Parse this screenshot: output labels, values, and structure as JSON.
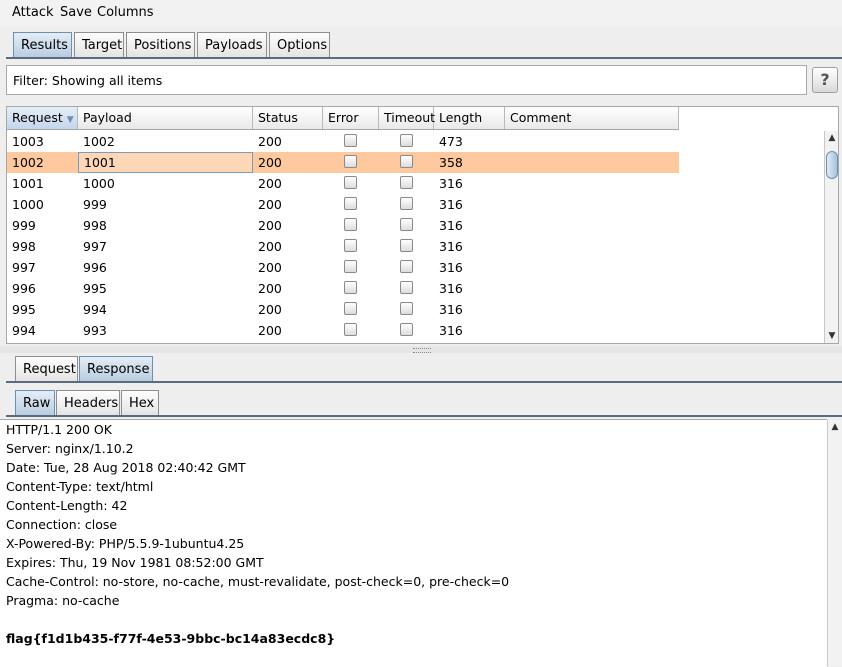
{
  "menu": [
    "Attack",
    "Save",
    "Columns"
  ],
  "main_tabs": [
    "Results",
    "Target",
    "Positions",
    "Payloads",
    "Options"
  ],
  "filter_text": "Filter: Showing all items",
  "help_label": "?",
  "columns": [
    "Request",
    "Payload",
    "Status",
    "Error",
    "Timeout",
    "Length",
    "Comment"
  ],
  "sort_indicator": "▼",
  "rows": [
    {
      "request": "1003",
      "payload": "1002",
      "status": "200",
      "length": "473"
    },
    {
      "request": "1002",
      "payload": "1001",
      "status": "200",
      "length": "358"
    },
    {
      "request": "1001",
      "payload": "1000",
      "status": "200",
      "length": "316"
    },
    {
      "request": "1000",
      "payload": "999",
      "status": "200",
      "length": "316"
    },
    {
      "request": "999",
      "payload": "998",
      "status": "200",
      "length": "316"
    },
    {
      "request": "998",
      "payload": "997",
      "status": "200",
      "length": "316"
    },
    {
      "request": "997",
      "payload": "996",
      "status": "200",
      "length": "316"
    },
    {
      "request": "996",
      "payload": "995",
      "status": "200",
      "length": "316"
    },
    {
      "request": "995",
      "payload": "994",
      "status": "200",
      "length": "316"
    },
    {
      "request": "994",
      "payload": "993",
      "status": "200",
      "length": "316"
    }
  ],
  "selected_row_index": 1,
  "detail_tabs": [
    "Request",
    "Response"
  ],
  "view_tabs": [
    "Raw",
    "Headers",
    "Hex"
  ],
  "response_lines": [
    "HTTP/1.1 200 OK",
    "Server: nginx/1.10.2",
    "Date: Tue, 28 Aug 2018 02:40:42 GMT",
    "Content-Type: text/html",
    "Content-Length: 42",
    "Connection: close",
    "X-Powered-By: PHP/5.5.9-1ubuntu4.25",
    "Expires: Thu, 19 Nov 1981 08:52:00 GMT",
    "Cache-Control: no-store, no-cache, must-revalidate, post-check=0, pre-check=0",
    "Pragma: no-cache"
  ],
  "response_body": "flag{f1d1b435-f77f-4e53-9bbc-bc14a83ecdc8}",
  "colors": {
    "selected_row": "#ffc9a0",
    "active_tab": "#b8cde0"
  }
}
